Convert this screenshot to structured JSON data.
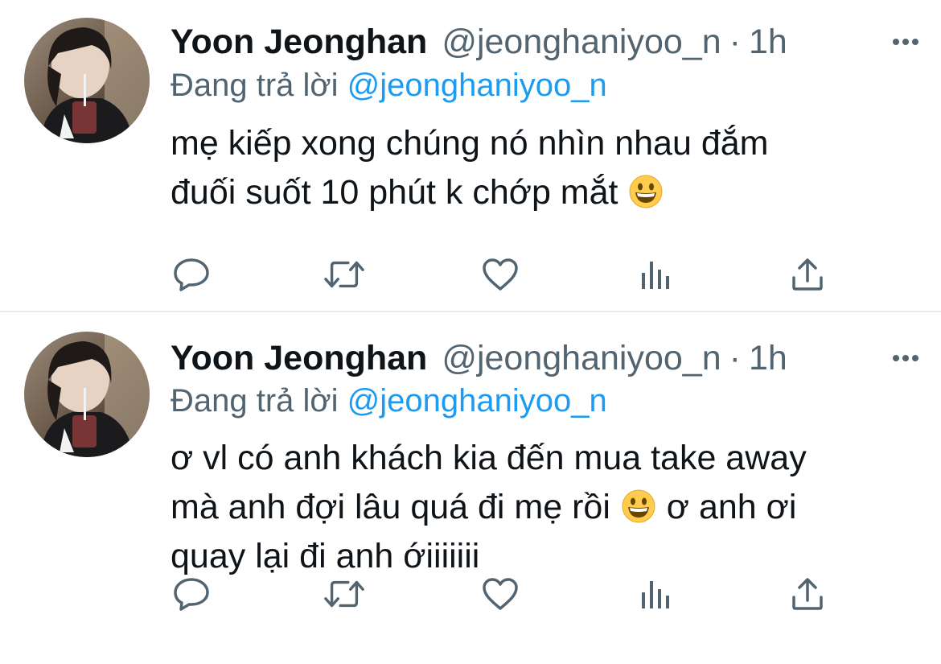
{
  "tweets": [
    {
      "display_name": "Yoon Jeonghan",
      "handle": "@jeonghaniyoo_n",
      "separator": "·",
      "time": "1h",
      "replying_prefix": "Đang trả lời",
      "replying_to": "@jeonghaniyoo_n",
      "lines": [
        "mẹ kiếp xong chúng nó nhìn nhau đắm",
        "đuối suốt 10 phút k chớp mắt"
      ],
      "emoji_after_line": 1
    },
    {
      "display_name": "Yoon Jeonghan",
      "handle": "@jeonghaniyoo_n",
      "separator": "·",
      "time": "1h",
      "replying_prefix": "Đang trả lời",
      "replying_to": "@jeonghaniyoo_n",
      "line1": "ơ vl có anh khách kia đến mua take away",
      "line2_before": "mà anh đợi lâu quá đi mẹ rồi",
      "line2_after": "ơ anh ơi",
      "line3": "quay lại đi anh ớiiiiiii"
    }
  ],
  "icons": {
    "more": "more-dots-icon",
    "reply": "reply-bubble-icon",
    "retweet": "retweet-icon",
    "like": "heart-icon",
    "analytics": "analytics-bars-icon",
    "share": "share-icon",
    "emoji": "grinning-face-emoji"
  },
  "colors": {
    "text": "#0f1419",
    "secondary": "#536471",
    "link": "#1d9bf0",
    "divider": "#e7e9ea"
  }
}
